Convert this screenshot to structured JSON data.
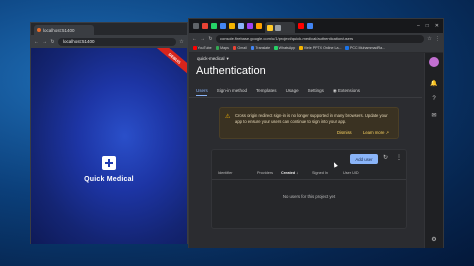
{
  "left_window": {
    "tab_title": "localhost:51400",
    "address": "localhost:51400",
    "ribbon": "DEBUG",
    "app_name": "Quick Medical"
  },
  "right_window": {
    "address": "console.firebase.google.com/u/1/project/quick-medical/authentication/users",
    "bookmarks": [
      {
        "label": "YouTube",
        "color": "#ff0000"
      },
      {
        "label": "Maps",
        "color": "#34a853"
      },
      {
        "label": "Gmail",
        "color": "#ea4335"
      },
      {
        "label": "Translate",
        "color": "#4285f4"
      },
      {
        "label": "WhatsApp",
        "color": "#25d366"
      },
      {
        "label": "Viele PPTX Online La...",
        "color": "#f4b400"
      },
      {
        "label": "PCC MuhammadRa...",
        "color": "#1a73e8"
      }
    ],
    "console": {
      "project": "quick-medical",
      "title": "Authentication",
      "tabs": [
        "Users",
        "Sign-in method",
        "Templates",
        "Usage",
        "Settings",
        "Extensions"
      ],
      "warning": {
        "text": "Cross origin redirect sign-in is no longer supported in many browsers. Update your app to ensure your users can continue to sign into your app.",
        "dismiss": "Dismiss",
        "learn_more": "Learn more"
      },
      "add_user": "Add user",
      "columns": [
        "Identifier",
        "Providers",
        "Created",
        "Signed In",
        "User UID"
      ],
      "empty_message": "No users for this project yet"
    }
  }
}
